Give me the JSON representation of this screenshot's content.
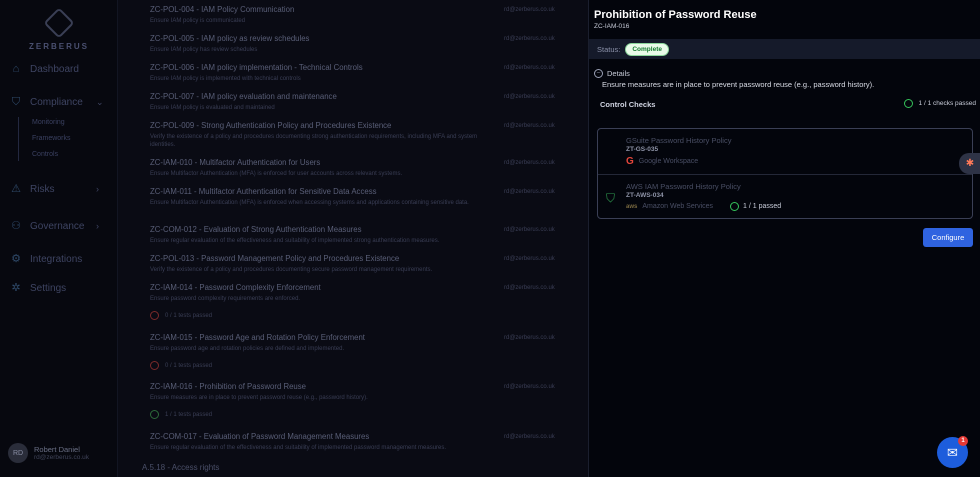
{
  "sidebar": {
    "brand": "ZERBERUS",
    "items": [
      {
        "label": "Dashboard",
        "icon": "home-icon"
      },
      {
        "label": "Compliance",
        "icon": "shield-icon"
      },
      {
        "label": "Risks",
        "icon": "warning-icon"
      },
      {
        "label": "Governance",
        "icon": "network-icon"
      },
      {
        "label": "Integrations",
        "icon": "integrations-icon"
      },
      {
        "label": "Settings",
        "icon": "gear-icon"
      }
    ],
    "compliance_sub": [
      "Monitoring",
      "Frameworks",
      "Controls"
    ],
    "user": {
      "initials": "RD",
      "name": "Robert Daniel",
      "email": "rd@zerberus.co.uk"
    }
  },
  "controls": [
    {
      "title": "ZC-POL-004 - IAM Policy Communication",
      "desc": "Ensure IAM policy is communicated",
      "email": "rd@zerberus.co.uk"
    },
    {
      "title": "ZC-POL-005 - IAM policy as review schedules",
      "desc": "Ensure IAM policy has review schedules",
      "email": "rd@zerberus.co.uk"
    },
    {
      "title": "ZC-POL-006 - IAM policy implementation - Technical Controls",
      "desc": "Ensure IAM policy is implemented with technical controls",
      "email": "rd@zerberus.co.uk"
    },
    {
      "title": "ZC-POL-007 - IAM policy evaluation and maintenance",
      "desc": "Ensure IAM policy is evaluated and maintained",
      "email": "rd@zerberus.co.uk"
    },
    {
      "title": "ZC-POL-009 - Strong Authentication Policy and Procedures Existence",
      "desc": "Verify the existence of a policy and procedures documenting strong authentication requirements, including MFA and system identities.",
      "email": "rd@zerberus.co.uk"
    },
    {
      "title": "ZC-IAM-010 - Multifactor Authentication for Users",
      "desc": "Ensure Multifactor Authentication (MFA) is enforced for user accounts across relevant systems.",
      "email": "rd@zerberus.co.uk"
    },
    {
      "title": "ZC-IAM-011 - Multifactor Authentication for Sensitive Data Access",
      "desc": "Ensure Multifactor Authentication (MFA) is enforced when accessing systems and applications containing sensitive data.",
      "email": "rd@zerberus.co.uk"
    },
    {
      "title": "ZC-COM-012 - Evaluation of Strong Authentication Measures",
      "desc": "Ensure regular evaluation of the effectiveness and suitability of implemented strong authentication measures.",
      "email": "rd@zerberus.co.uk"
    },
    {
      "title": "ZC-POL-013 - Password Management Policy and Procedures Existence",
      "desc": "Verify the existence of a policy and procedures documenting secure password management requirements.",
      "email": "rd@zerberus.co.uk"
    },
    {
      "title": "ZC-IAM-014 - Password Complexity Enforcement",
      "desc": "Ensure password complexity requirements are enforced.",
      "email": "rd@zerberus.co.uk",
      "status": "0 / 1 tests passed",
      "ok": false
    },
    {
      "title": "ZC-IAM-015 - Password Age and Rotation Policy Enforcement",
      "desc": "Ensure password age and rotation policies are defined and implemented.",
      "email": "rd@zerberus.co.uk",
      "status": "0 / 1 tests passed",
      "ok": false
    },
    {
      "title": "ZC-IAM-016 - Prohibition of Password Reuse",
      "desc": "Ensure measures are in place to prevent password reuse (e.g., password history).",
      "email": "rd@zerberus.co.uk",
      "status": "1 / 1 tests passed",
      "ok": true
    },
    {
      "title": "ZC-COM-017 - Evaluation of Password Management Measures",
      "desc": "Ensure regular evaluation of the effectiveness and suitability of implemented password management measures.",
      "email": "rd@zerberus.co.uk"
    }
  ],
  "section_footer": "A.5.18 - Access rights",
  "panel": {
    "title": "Prohibition of Password Reuse",
    "code": "ZC-IAM-016",
    "status_label": "Status:",
    "status_value": "Complete",
    "details_label": "Details",
    "details_text": "Ensure measures are in place to prevent password reuse (e.g., password history).",
    "control_checks_label": "Control Checks",
    "checks_summary": "1 / 1 checks passed",
    "checks": [
      {
        "title": "GSuite Password History Policy",
        "code": "ZT-GS-035",
        "provider": "Google Workspace",
        "provider_logo": "G"
      },
      {
        "title": "AWS IAM Password History Policy",
        "code": "ZT-AWS-034",
        "provider": "Amazon Web Services",
        "provider_logo": "aws",
        "passed": "1 / 1 passed"
      }
    ],
    "configure_label": "Configure"
  },
  "chat": {
    "badge": "1"
  },
  "colors": {
    "accent": "#2f63e0",
    "success": "#35c25a",
    "fail": "#7a2a2a"
  }
}
